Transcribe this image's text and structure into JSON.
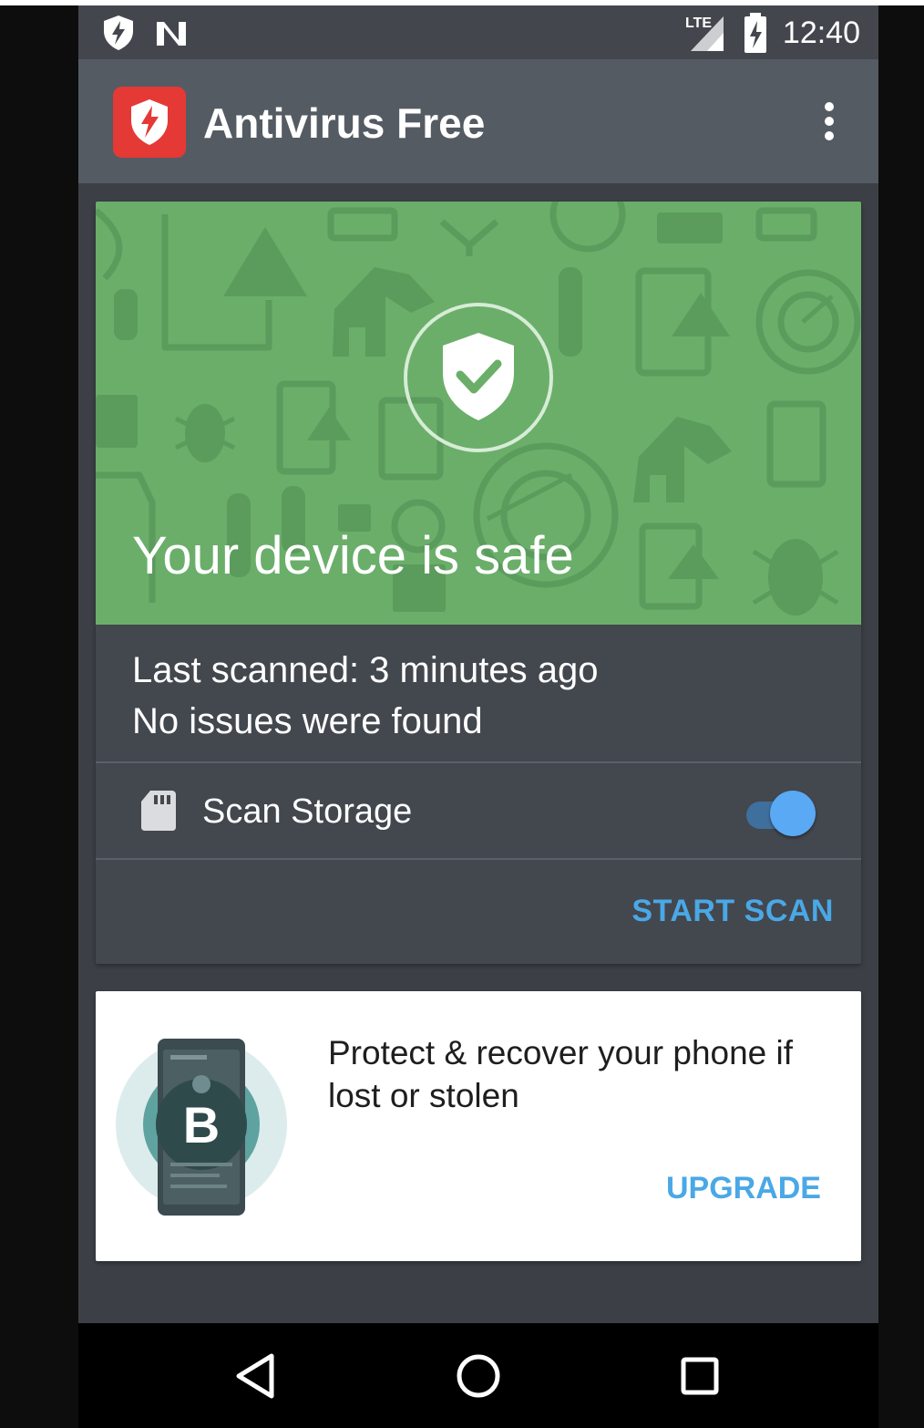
{
  "status_bar": {
    "time": "12:40",
    "network": "LTE",
    "icons": [
      "shield-notification-icon",
      "n-notification-icon",
      "lte-signal-icon",
      "battery-charging-icon"
    ]
  },
  "app_bar": {
    "title": "Antivirus Free",
    "icons": [
      "app-shield-logo-icon",
      "more-vert-icon"
    ]
  },
  "main_card": {
    "hero_title": "Your device is safe",
    "hero_icon": "shield-check-icon",
    "last_scanned": "Last scanned: 3 minutes ago",
    "issues": "No issues were found",
    "scan_storage": {
      "label": "Scan Storage",
      "icon": "sd-card-icon",
      "enabled": true
    },
    "action_label": "START SCAN"
  },
  "promo_card": {
    "text": "Protect & recover your phone if lost or stolen",
    "action_label": "UPGRADE",
    "image": "phone-b-logo-illustration",
    "brand_letter": "B"
  },
  "nav_bar": {
    "buttons": [
      "back-icon",
      "home-icon",
      "recents-icon"
    ]
  },
  "colors": {
    "hero_green": "#6aae6a",
    "accent_blue": "#4aa8e6",
    "app_bar": "#555b63",
    "card_bg": "#43474e",
    "logo_red": "#e53935"
  }
}
